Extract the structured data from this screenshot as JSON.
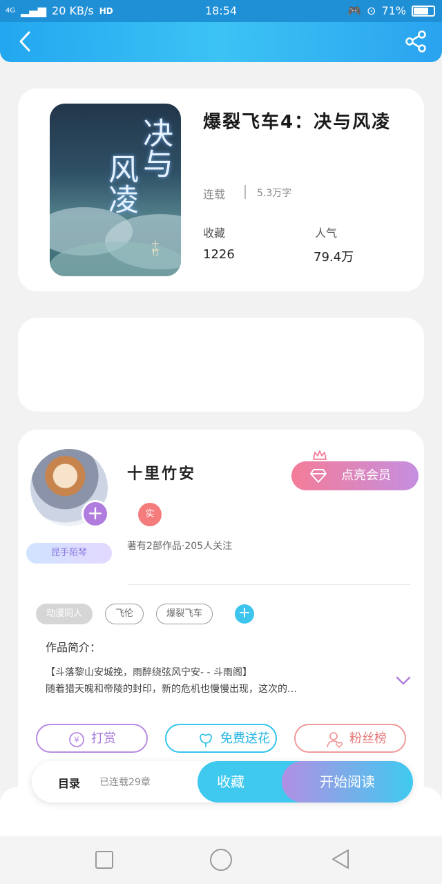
{
  "status_bar": {
    "network": "4G",
    "speed": "20 KB/s",
    "hd": "HD",
    "time": "18:54",
    "battery": "71%",
    "battery_level": 0.71
  },
  "header": {
    "back_icon": "chevron-left-icon",
    "share_icon": "share-icon"
  },
  "book": {
    "title": "爆裂飞车4：决与风凌",
    "cover_title_line1": "决与",
    "cover_title_line2": "风凌",
    "cover_author": "十竹",
    "status": "连载",
    "word_count": "5.3万字",
    "favorites_label": "收藏",
    "favorites_value": "1226",
    "popularity_label": "人气",
    "popularity_value": "79.4万"
  },
  "author": {
    "name": "十里竹安",
    "real_badge": "实",
    "level_badge": "昆手陌琴",
    "stats": "著有2部作品·205人关注",
    "vip_button": "点亮会员"
  },
  "tags": [
    "动漫同人",
    "飞伦",
    "爆裂飞车"
  ],
  "intro": {
    "label": "作品简介：",
    "line1": "【斗落黎山安城挽，雨醉绕弦风宁安- - 斗雨阁】",
    "line2": "随着猎天魄和帝陵的封印，新的危机也慢慢出现，这次的…"
  },
  "actions": {
    "reward": "打赏",
    "flower": "免费送花",
    "fans": "粉丝榜"
  },
  "bottom_bar": {
    "toc": "目录",
    "serial": "已连载29章",
    "favorite": "收藏",
    "read": "开始阅读"
  },
  "colors": {
    "header": "#2aa3ef",
    "accent_blue": "#40c9ef",
    "accent_purple": "#b07cde",
    "accent_pink": "#f47c98"
  }
}
